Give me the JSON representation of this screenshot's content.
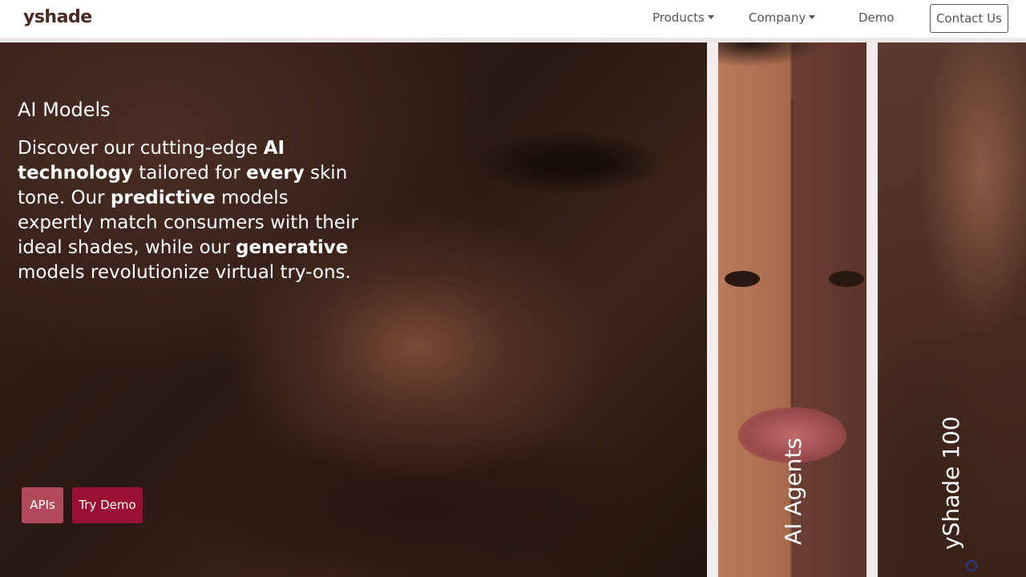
{
  "nav": {
    "logo": "yshade",
    "products": "Products",
    "company": "Company",
    "demo": "Demo",
    "contact": "Contact Us"
  },
  "hero": {
    "title": "AI Models",
    "body_parts": [
      "Discover our cutting-edge ",
      "AI technology",
      " tailored for ",
      "every",
      " skin tone. Our ",
      "predictive",
      " models expertly match consumers with their ideal shades, while our ",
      "generative",
      " models revolutionize virtual try-ons."
    ],
    "btn_apis": "APIs",
    "btn_demo": "Try Demo"
  },
  "panels": {
    "agents_label": "AI Agents",
    "yshade_label": "yShade 100"
  },
  "colors": {
    "accent_dark": "#9a0f34",
    "accent_light": "#b04a5a",
    "logo": "#4a2a22"
  }
}
